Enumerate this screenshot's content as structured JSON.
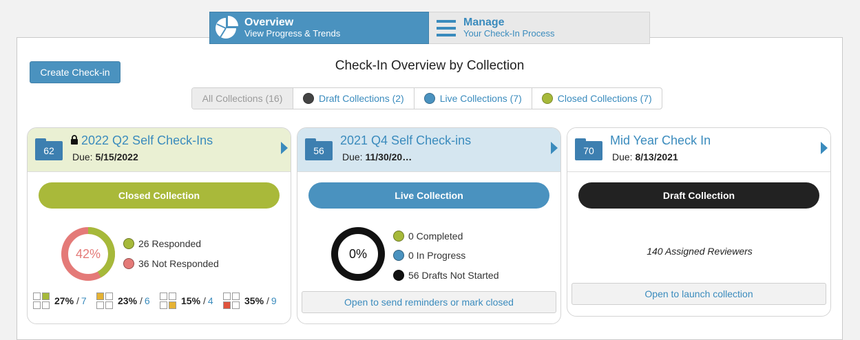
{
  "nav": {
    "overview": {
      "title": "Overview",
      "subtitle": "View Progress & Trends"
    },
    "manage": {
      "title": "Manage",
      "subtitle": "Your Check-In Process"
    }
  },
  "create_button": "Create Check-in",
  "page_title": "Check-In Overview by Collection",
  "filters": [
    {
      "label": "All Collections (16)",
      "dot": null
    },
    {
      "label": "Draft Collections (2)",
      "dot": "#444444"
    },
    {
      "label": "Live Collections (7)",
      "dot": "#4a92bf"
    },
    {
      "label": "Closed Collections (7)",
      "dot": "#a6b93a"
    }
  ],
  "cards": [
    {
      "count": "62",
      "title": "2022 Q2 Self Check-Ins",
      "locked": true,
      "due_label": "Due:",
      "due_date": "5/15/2022",
      "header_color": "#eaf0d3",
      "status": "Closed Collection",
      "status_color": "#a9b93a",
      "donut_label": "42%",
      "donut_percent": 42,
      "legend": [
        {
          "label": "26 Responded",
          "color": "#a6b93a"
        },
        {
          "label": "36 Not Responded",
          "color": "#e47a78"
        }
      ],
      "stats": [
        {
          "pct": "27%",
          "sep": "/",
          "num": "7"
        },
        {
          "pct": "23%",
          "sep": "/",
          "num": "6"
        },
        {
          "pct": "15%",
          "sep": "/",
          "num": "4"
        },
        {
          "pct": "35%",
          "sep": "/",
          "num": "9"
        }
      ]
    },
    {
      "count": "56",
      "title": "2021 Q4 Self Check-ins",
      "due_label": "Due:",
      "due_date": "11/30/20…",
      "header_color": "#d5e6f0",
      "status": "Live Collection",
      "status_color": "#4a92bf",
      "donut_label": "0%",
      "legend": [
        {
          "label": "0 Completed",
          "color": "#a6b93a"
        },
        {
          "label": "0 In Progress",
          "color": "#4a92bf"
        },
        {
          "label": "56 Drafts Not Started",
          "color": "#111111"
        }
      ],
      "footer_button": "Open to send reminders or mark closed"
    },
    {
      "count": "70",
      "title": "Mid Year Check In",
      "due_label": "Due:",
      "due_date": "8/13/2021",
      "header_color": "#ffffff",
      "status": "Draft Collection",
      "status_color": "#222222",
      "assigned": "140 Assigned Reviewers",
      "footer_button": "Open to launch collection"
    }
  ]
}
